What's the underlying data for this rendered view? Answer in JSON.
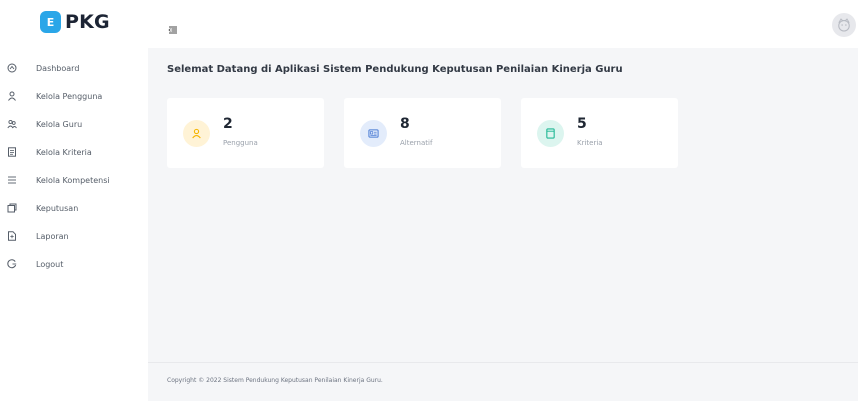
{
  "brand": {
    "badge": "E",
    "name": "PKG",
    "badge_color": "#2aa6e8"
  },
  "sidebar": {
    "items": [
      {
        "label": "Dashboard",
        "icon": "dashboard-icon"
      },
      {
        "label": "Kelola Pengguna",
        "icon": "user-icon"
      },
      {
        "label": "Kelola Guru",
        "icon": "users-icon"
      },
      {
        "label": "Kelola Kriteria",
        "icon": "document-icon"
      },
      {
        "label": "Kelola Kompetensi",
        "icon": "list-icon"
      },
      {
        "label": "Keputusan",
        "icon": "copy-icon"
      },
      {
        "label": "Laporan",
        "icon": "file-icon"
      },
      {
        "label": "Logout",
        "icon": "logout-icon"
      }
    ]
  },
  "header": {
    "toggle_icon": "menu-toggle-icon",
    "avatar_icon": "avatar-icon"
  },
  "main": {
    "welcome": "Selemat Datang di Aplikasi Sistem Pendukung Keputusan Penilaian Kinerja Guru",
    "cards": [
      {
        "value": "2",
        "label": "Pengguna",
        "icon": "user-icon",
        "icon_bg": "#fff3d6",
        "icon_color": "#f5b400"
      },
      {
        "value": "8",
        "label": "Alternatif",
        "icon": "id-card-icon",
        "icon_bg": "#e3ecfb",
        "icon_color": "#4a7bd4"
      },
      {
        "value": "5",
        "label": "Kriteria",
        "icon": "book-icon",
        "icon_bg": "#dcf5ef",
        "icon_color": "#1fb894"
      }
    ]
  },
  "footer": {
    "text": "Copyright © 2022 Sistem Pendukung Keputusan Penilaian Kinerja Guru."
  }
}
